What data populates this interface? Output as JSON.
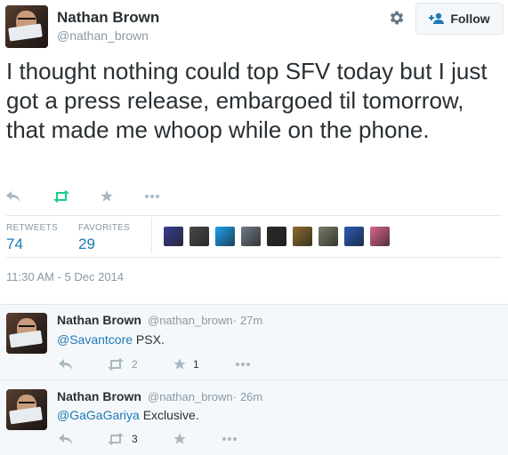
{
  "tweet": {
    "author_name": "Nathan Brown",
    "author_handle": "@nathan_brown",
    "follow_label": "Follow",
    "text": "I thought nothing could top SFV today but I just got a press release, embargoed til tomorrow, that made me whoop while on the phone.",
    "stats": {
      "retweets_label": "RETWEETS",
      "retweets_value": "74",
      "favorites_label": "FAVORITES",
      "favorites_value": "29"
    },
    "timestamp": "11:30 AM - 5 Dec 2014"
  },
  "favoriters": [
    {
      "name": "favoriter-avatar-1",
      "color": "#3b3f8f"
    },
    {
      "name": "favoriter-avatar-2",
      "color": "#4a4a4a"
    },
    {
      "name": "favoriter-avatar-3",
      "color": "#1da1f2"
    },
    {
      "name": "favoriter-avatar-4",
      "color": "#6f7b86"
    },
    {
      "name": "favoriter-avatar-5",
      "color": "#2b2b2b"
    },
    {
      "name": "favoriter-avatar-6",
      "color": "#8b6c2e"
    },
    {
      "name": "favoriter-avatar-7",
      "color": "#7b7b68"
    },
    {
      "name": "favoriter-avatar-8",
      "color": "#2a5bb7"
    },
    {
      "name": "favoriter-avatar-9",
      "color": "#d9668f"
    }
  ],
  "replies": [
    {
      "author_name": "Nathan Brown",
      "author_handle": "@nathan_brown",
      "time": "· 27m",
      "mention": "@Savantcore",
      "text": " PSX.",
      "retweet_count": "2",
      "favorite_count": "1"
    },
    {
      "author_name": "Nathan Brown",
      "author_handle": "@nathan_brown",
      "time": "· 26m",
      "mention": "@GaGaGariya",
      "text": " Exclusive.",
      "retweet_count": "3",
      "favorite_count": ""
    }
  ],
  "colors": {
    "accent": "#1d79b8",
    "retweeted_green": "#19cf86",
    "icon_gray": "#aab8c2",
    "reply_bg": "#f5f8fa"
  }
}
